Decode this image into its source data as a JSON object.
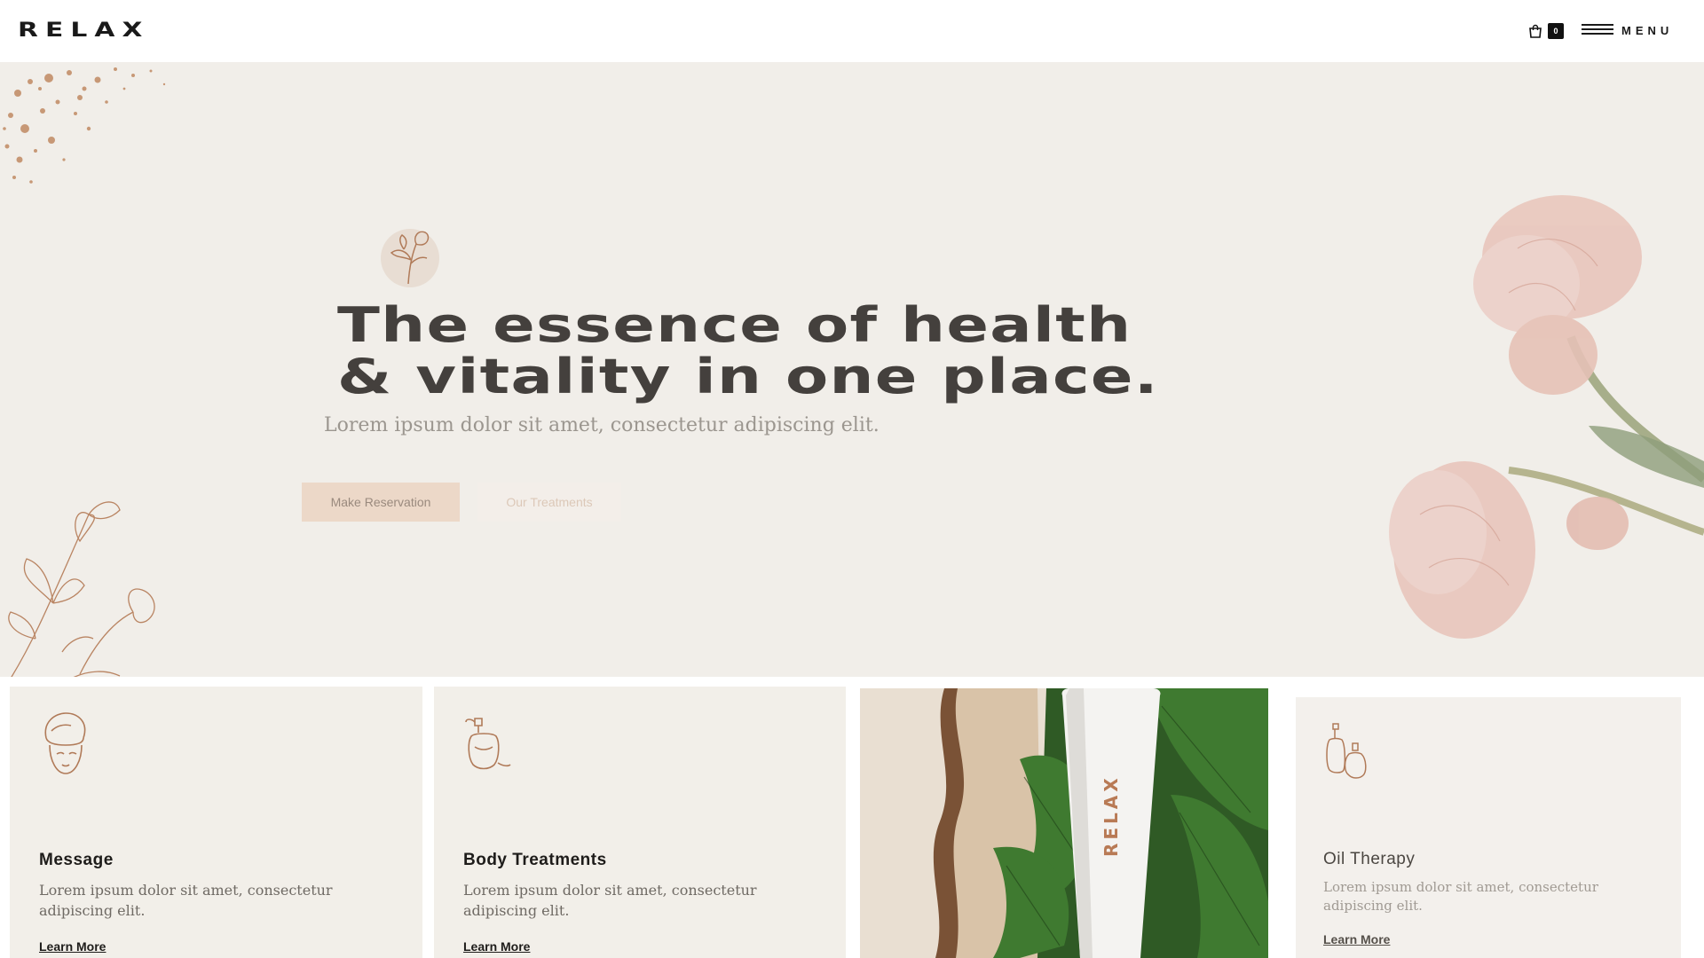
{
  "header": {
    "logo": "RELAX",
    "cart_count": "0",
    "menu_label": "MENU"
  },
  "hero": {
    "headline_line1": "The essence of health",
    "headline_line2": "& vitality in one place.",
    "subhead": "Lorem ipsum dolor sit amet, consectetur adipiscing elit.",
    "primary_button": "Make Reservation",
    "secondary_button": "Our Treatments"
  },
  "cards": [
    {
      "icon": "towel-face-icon",
      "title": "Message",
      "text": "Lorem ipsum dolor sit amet, consectetur adipiscing elit.",
      "link": "Learn More"
    },
    {
      "icon": "perfume-bottle-icon",
      "title": "Body Treatments",
      "text": "Lorem ipsum dolor sit amet, consectetur adipiscing elit.",
      "link": "Learn More"
    },
    {
      "icon": "product-photo",
      "tube_label": "RELAX"
    },
    {
      "icon": "oil-bottles-icon",
      "title": "Oil Therapy",
      "text": "Lorem ipsum dolor sit amet, consectetur adipiscing elit.",
      "link": "Learn More"
    }
  ],
  "colors": {
    "hero_bg": "#f1eee9",
    "accent_copper": "#b87a55",
    "headline": "#44403d",
    "primary_button_bg": "#ecd8c8"
  }
}
